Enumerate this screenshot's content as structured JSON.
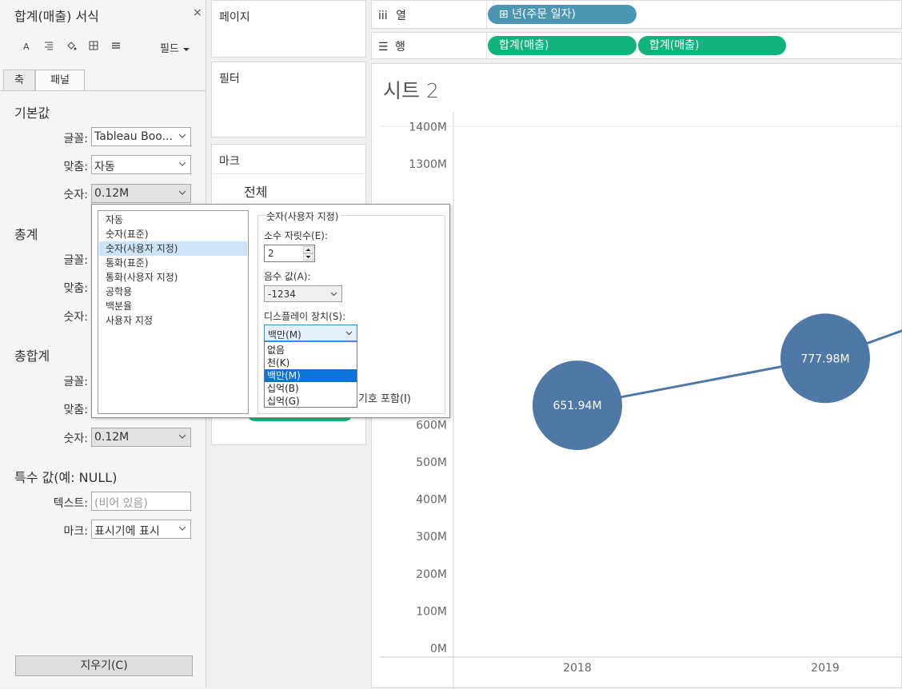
{
  "format_panel": {
    "title": "합계(매출) 서식",
    "close_glyph": "×",
    "fields_label": "필드",
    "tabs": [
      "축",
      "패널"
    ],
    "sections": {
      "default": {
        "title": "기본값",
        "font_label": "글꼴:",
        "font_value": "Tableau Boo...",
        "align_label": "맞춤:",
        "align_value": "자동",
        "number_label": "숫자:",
        "number_value": "0.12M"
      },
      "totals": {
        "title": "총계",
        "font_label": "글꼴:",
        "align_label": "맞춤:",
        "number_label": "숫자:"
      },
      "grand_totals": {
        "title": "총합계",
        "font_label": "글꼴:",
        "align_label": "맞춤:",
        "number_label": "숫자:",
        "number_value": "0.12M"
      },
      "special_values": {
        "title": "특수 값(예: NULL)",
        "text_label": "텍스트:",
        "text_placeholder": "(비어 있음)",
        "marks_label": "마크:",
        "marks_value": "표시기에 표시"
      }
    },
    "clear_label": "지우기(C)"
  },
  "shelves": {
    "pages": "페이지",
    "filters": "필터",
    "marks": "마크",
    "marks_all": "전체",
    "columns_label": "열",
    "columns_glyph": "iii",
    "rows_label": "행",
    "rows_glyph": "☰",
    "column_pill": "⊞ 년(주문 일자)",
    "row_pills": [
      "합계(매출)",
      "합계(매출)"
    ]
  },
  "view": {
    "sheet_title": "시트 2"
  },
  "number_popup": {
    "formats": [
      "자동",
      "숫자(표준)",
      "숫자(사용자 지정)",
      "통화(표준)",
      "통화(사용자 지정)",
      "공학용",
      "백분율",
      "사용자 지정"
    ],
    "selected_format": "숫자(사용자 지정)",
    "group_title": "숫자(사용자 지정)",
    "decimal_label": "소수 자릿수(E):",
    "decimal_value": "2",
    "negative_label": "음수 값(A):",
    "negative_value": "-1234",
    "units_label": "디스플레이 장치(S):",
    "units_value": "백만(M)",
    "units_options": [
      "없음",
      "천(K)",
      "백만(M)",
      "십억(B)",
      "십억(G)"
    ],
    "prefix_label_partial": "기호 포함(I)"
  },
  "colors": {
    "mark": "#4e79a7",
    "pill_green": "#10b37b",
    "pill_blue": "#4b97b3"
  },
  "chart_data": {
    "type": "line",
    "title": "시트 2",
    "categories": [
      "2018",
      "2019"
    ],
    "series": [
      {
        "values": [
          651.94,
          777.98
        ]
      }
    ],
    "value_labels": [
      "651.94M",
      "777.98M"
    ],
    "y_ticks": [
      "0M",
      "100M",
      "200M",
      "300M",
      "400M",
      "500M",
      "600M",
      "1300M",
      "1400M"
    ],
    "ylim": [
      0,
      1450
    ],
    "y_unit": "M",
    "grid": false,
    "continues_right": true
  }
}
